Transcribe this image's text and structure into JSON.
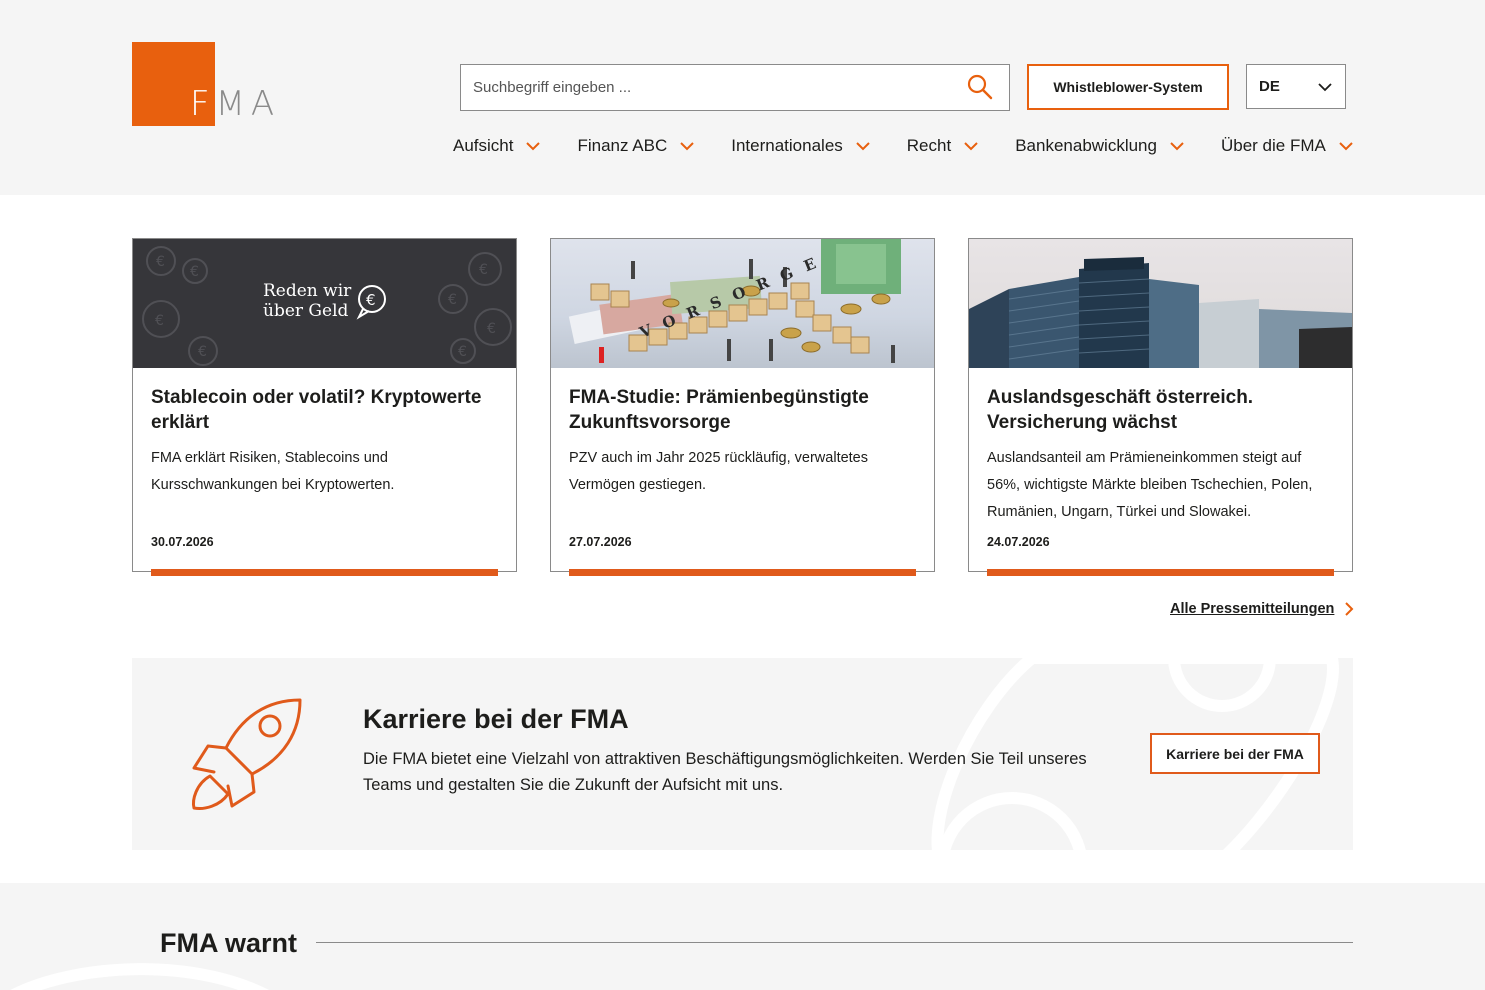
{
  "logo": {
    "text_first": "F",
    "text_rest": "MA"
  },
  "search": {
    "placeholder": "Suchbegriff eingeben ..."
  },
  "header": {
    "whistleblower_label": "Whistleblower-System",
    "language": "DE"
  },
  "nav": [
    {
      "label": "Aufsicht"
    },
    {
      "label": "Finanz ABC"
    },
    {
      "label": "Internationales"
    },
    {
      "label": "Recht"
    },
    {
      "label": "Bankenabwicklung"
    },
    {
      "label": "Über die FMA"
    }
  ],
  "cards": [
    {
      "image_text_line1": "Reden wir",
      "image_text_line2": "über Geld",
      "title": "Stablecoin oder volatil? Kryptowerte erklärt",
      "text": "FMA erklärt Risiken, Stablecoins und Kursschwankungen bei Kryptowerten.",
      "date": "30.07.2026"
    },
    {
      "image_word": "VORSORGE",
      "title": "FMA-Studie: Prämienbegünstigte Zukunftsvorsorge",
      "text": "PZV auch im Jahr 2025 rückläufig, verwaltetes Vermögen gestiegen.",
      "date": "27.07.2026"
    },
    {
      "title": "Auslandsgeschäft österreich. Versicherung wächst",
      "text": "Auslandsanteil am Prämieneinkommen steigt auf 56%, wichtigste Märkte bleiben Tschechien, Polen, Rumänien, Ungarn, Türkei und Slowakei.",
      "date": "24.07.2026"
    }
  ],
  "more_link": "Alle Pressemitteilungen",
  "career": {
    "title": "Karriere bei der FMA",
    "text": "Die FMA bietet eine Vielzahl von attraktiven Beschäftigungsmöglichkeiten. Werden Sie Teil unseres Teams und gestalten Sie die Zukunft der Aufsicht mit uns.",
    "button": "Karriere bei der FMA"
  },
  "warnt": {
    "title": "FMA warnt"
  },
  "colors": {
    "accent": "#e8600e",
    "background": "#f5f5f5",
    "text": "#1d1d1b"
  }
}
